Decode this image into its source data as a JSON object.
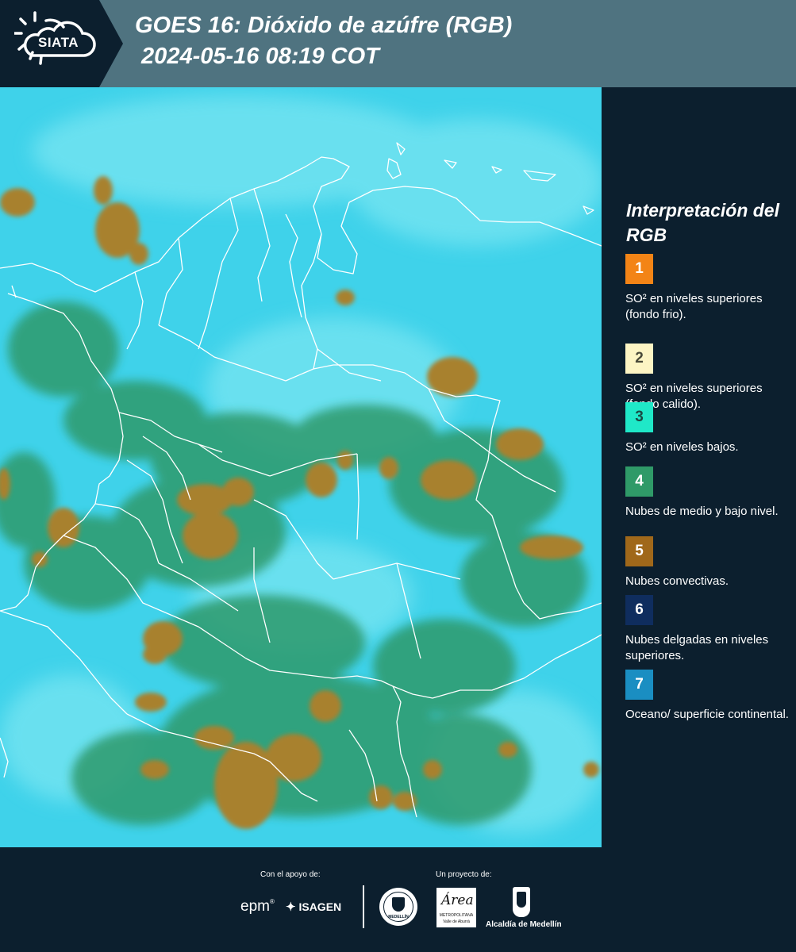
{
  "header": {
    "logo_text": "SIATA",
    "title_line1": "GOES 16: Dióxido de azúfre (RGB)",
    "title_line2": " 2024-05-16 08:19 COT"
  },
  "legend": {
    "title": "Interpretación del RGB",
    "items": [
      {
        "number": "1",
        "label": "SO² en niveles superiores (fondo frio).",
        "color": "#f38416",
        "number_color": "#ffffff"
      },
      {
        "number": "2",
        "label": "SO² en niveles superiores (fondo calido).",
        "color": "#fdf5c4",
        "number_color": "#4a4a3a"
      },
      {
        "number": "3",
        "label": "SO² en niveles bajos.",
        "color": "#1fe8c8",
        "number_color": "#1a4a44"
      },
      {
        "number": "4",
        "label": "Nubes de medio y bajo nivel.",
        "color": "#2f9a68",
        "number_color": "#ffffff"
      },
      {
        "number": "5",
        "label": "Nubes convectivas.",
        "color": "#a0681a",
        "number_color": "#ffffff"
      },
      {
        "number": "6",
        "label": "Nubes delgadas en niveles superiores.",
        "color": "#0f2d5e",
        "number_color": "#ffffff"
      },
      {
        "number": "7",
        "label": "Oceano/ superficie continental.",
        "color": "#1a8ec2",
        "number_color": "#ffffff"
      }
    ]
  },
  "map": {
    "ocean_color": "#3fd2ea",
    "cloud_color": "#a8812e",
    "green_color": "#2e9a6c"
  },
  "footer": {
    "support_label": "Con el apoyo de:",
    "project_label": "Un proyecto de:",
    "sponsor_epm": "epm",
    "sponsor_isagen": "ISAGEN",
    "partner_area_name": "Área",
    "partner_area_sub": "METROPOLITANA",
    "partner_area_sub2": "Valle de Aburrá",
    "partner_medellin_seal": "MEDELLÍN",
    "partner_alcaldia": "Alcaldía de Medellín"
  }
}
